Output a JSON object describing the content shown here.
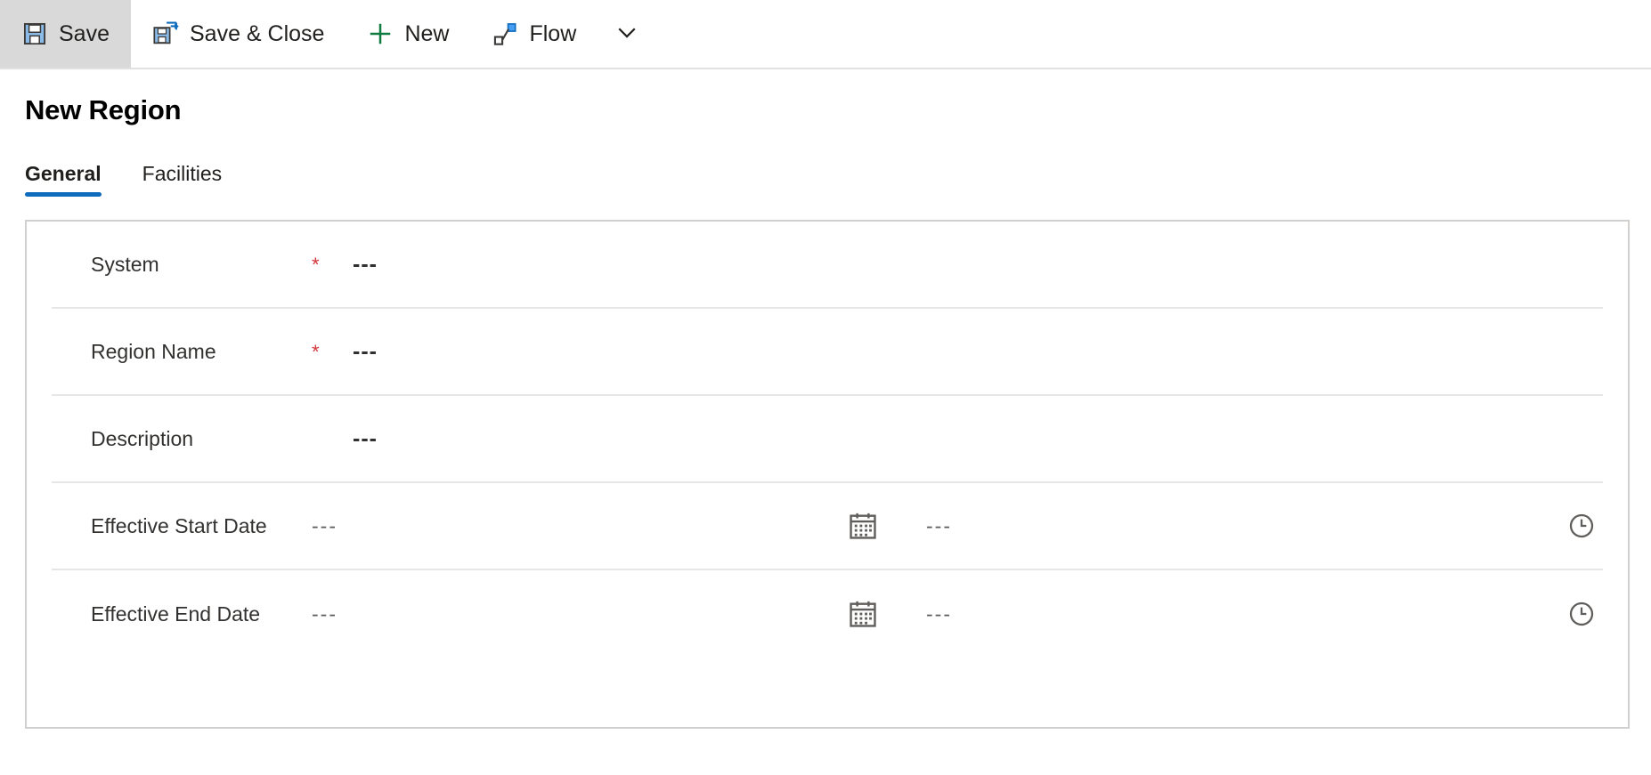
{
  "commandbar": {
    "buttons": [
      {
        "label": "Save",
        "icon": "save-icon",
        "selected": true
      },
      {
        "label": "Save & Close",
        "icon": "save-and-close-icon",
        "selected": false
      },
      {
        "label": "New",
        "icon": "plus-icon",
        "selected": false
      },
      {
        "label": "Flow",
        "icon": "flow-icon",
        "selected": false
      }
    ],
    "overflow_icon": "chevron-down-icon"
  },
  "page": {
    "title": "New Region"
  },
  "tabs": [
    {
      "label": "General",
      "active": true
    },
    {
      "label": "Facilities",
      "active": false
    }
  ],
  "form": {
    "rows": [
      {
        "label": "System",
        "required": true,
        "value": "---"
      },
      {
        "label": "Region Name",
        "required": true,
        "value": "---"
      },
      {
        "label": "Description",
        "required": false,
        "value": "---"
      },
      {
        "label": "Effective Start Date",
        "required": false,
        "date_value": "---",
        "time_value": "---",
        "date_icon": "calendar-icon",
        "time_icon": "clock-icon"
      },
      {
        "label": "Effective End Date",
        "required": false,
        "date_value": "---",
        "time_value": "---",
        "date_icon": "calendar-icon",
        "time_icon": "clock-icon"
      }
    ]
  },
  "colors": {
    "accent": "#0f6cbd",
    "required": "#d13438",
    "selected_bg": "#d9d9d9",
    "border": "#d2d0ce"
  }
}
